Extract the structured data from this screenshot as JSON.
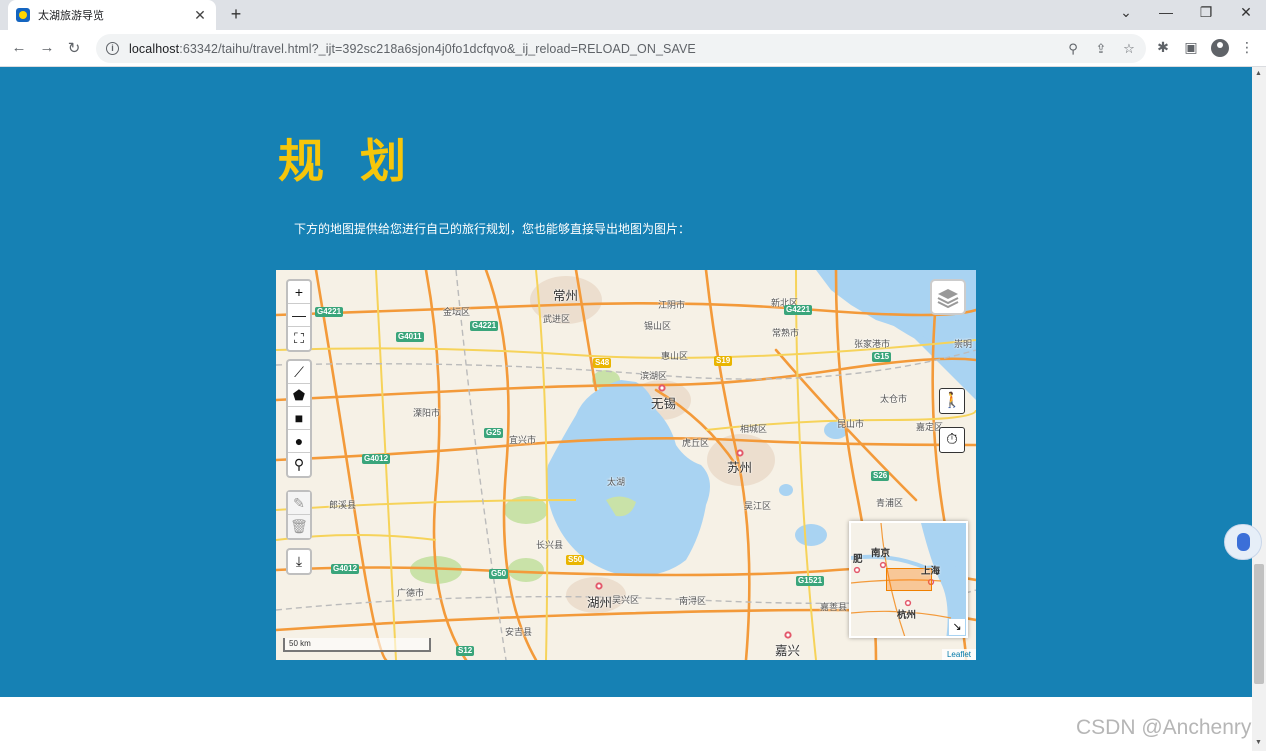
{
  "browser": {
    "tab_title": "太湖旅游导览",
    "tab_close": "✕",
    "new_tab": "+",
    "url_host": "localhost",
    "url_rest": ":63342/taihu/travel.html?_ijt=392sc218a6sjon4j0fo1dcfqvo&_ij_reload=RELOAD_ON_SAVE",
    "minimize": "—",
    "restore": "❐",
    "close": "✕",
    "tab_list": "⌄"
  },
  "page": {
    "heading": "规 划",
    "intro": "下方的地图提供给您进行自己的旅行规划，您也能够直接导出地图为图片："
  },
  "map": {
    "zoom_in": "+",
    "zoom_out": "—",
    "fullscreen": "⛶",
    "draw_line": "⟋",
    "draw_polygon": "⬟",
    "draw_rectangle": "■",
    "draw_circle": "●",
    "draw_marker": "⚲",
    "edit": "✎",
    "delete": "🗑",
    "export": "⤓",
    "walk": "🚶",
    "timer": "⏱",
    "scale_label": "50 km",
    "attribution": "Leaflet",
    "labels": {
      "changzhou": "常州",
      "wuxi": "无锡",
      "suzhou": "苏州",
      "huzhou": "湖州",
      "jiaxing": "嘉兴",
      "taihu": "太湖",
      "jintan": "金坛区",
      "wujin": "武进区",
      "liyang": "溧阳市",
      "yixing": "宜兴市",
      "langxi": "郎溪县",
      "changxing": "长兴县",
      "wuxing": "吴兴区",
      "nanxun": "南浔区",
      "wujiang": "吴江区",
      "xiangcheng": "相城区",
      "kunshan": "昆山市",
      "huqiu": "虎丘区",
      "changshu": "常熟市",
      "binhu": "滨湖区",
      "xishan": "锡山区",
      "huishan": "惠山区",
      "qingpu": "青浦区",
      "jiashan": "嘉善县",
      "taicang": "太仓市",
      "jiading": "嘉定区",
      "guangde": "广德市",
      "anji": "安吉县",
      "zhangjiagang": "张家港市",
      "jiangyin": "江阴市",
      "xinbei": "新北区",
      "chongming": "崇明"
    },
    "shields": {
      "g4221a": "G4221",
      "g4221b": "G4221",
      "g4221c": "G4221",
      "g4011": "G4011",
      "g25": "G25",
      "g4012a": "G4012",
      "g4012b": "G4012",
      "g50": "G50",
      "s48": "S48",
      "s19": "S19",
      "g15": "G15",
      "s26": "S26",
      "g1521": "G1521",
      "s12": "S12",
      "s50": "S50"
    },
    "minimap": {
      "nanjing": "南京",
      "shanghai": "上海",
      "hangzhou": "杭州",
      "hefei": "肥",
      "toggle": "↘"
    }
  },
  "watermark": "CSDN @Anchenry"
}
